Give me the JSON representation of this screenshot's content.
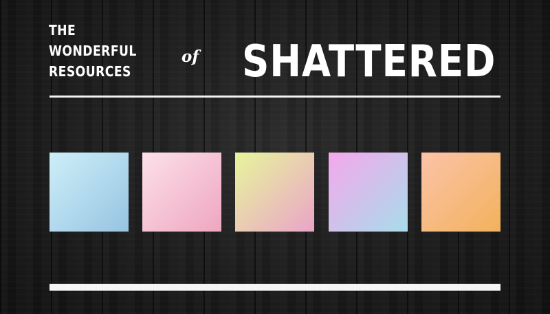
{
  "banner": {
    "tagline": [
      "THE",
      "WONDERFUL",
      "RESOURCES"
    ],
    "connector": "of",
    "headline": "SHATTERED"
  },
  "colors": {
    "text": "#ffffff",
    "rule": "#f2f2f2",
    "background": "#1c1c1c"
  },
  "swatches": [
    {
      "name": "blue",
      "from": "#cdeff8",
      "to": "#97c3e2"
    },
    {
      "name": "pink",
      "from": "#fce0ea",
      "to": "#efa6c0"
    },
    {
      "name": "lime-pink",
      "from": "#e8f59c",
      "to": "#eaa4c8"
    },
    {
      "name": "violet-blue",
      "from": "#f5a8ec",
      "to": "#a8dcea"
    },
    {
      "name": "peach-orange",
      "from": "#fcc3a8",
      "to": "#f2b25c"
    }
  ]
}
